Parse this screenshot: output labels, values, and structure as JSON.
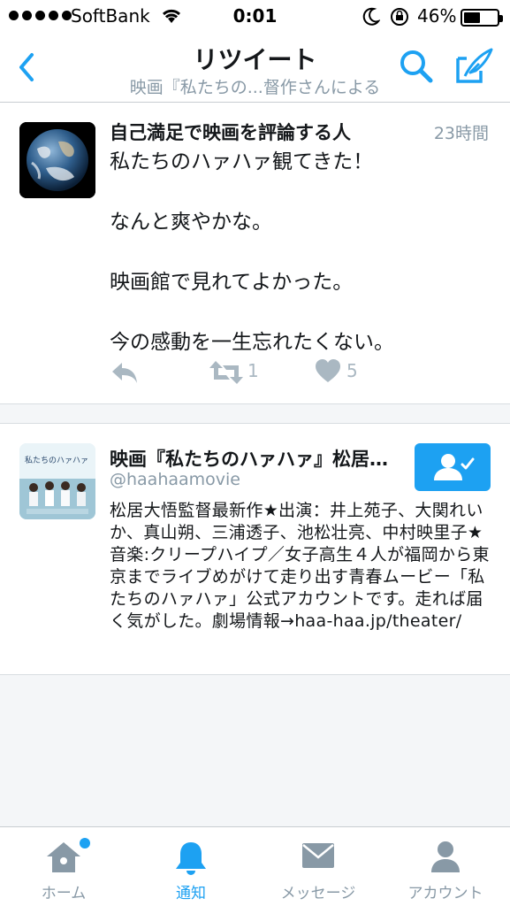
{
  "status_bar": {
    "carrier": "SoftBank",
    "time": "0:01",
    "battery_percent": "46%",
    "battery_level": 0.46
  },
  "nav": {
    "title": "リツイート",
    "subtitle": "映画『私たちの...督作さんによる",
    "icons": [
      "chevron-left-icon",
      "search-icon",
      "compose-icon"
    ],
    "accent_color": "#1DA1F2"
  },
  "tweet": {
    "author_name": "自己満足で映画を評論する人",
    "time": "23時間",
    "text": "私たちのハァハァ観てきた！\n\nなんと爽やかな。\n\n映画館で見れてよかった。\n\n今の感動を一生忘れたくない。",
    "retweet_count": "1",
    "like_count": "5"
  },
  "user": {
    "name": "映画『私たちのハァハァ』松居大悟監督作",
    "handle": "@haahaamovie",
    "avatar_caption": "私たちのハァハァ",
    "bio": "松居大悟監督最新作★出演：井上苑子、大関れいか、真山朔、三浦透子、池松壮亮、中村映里子★音楽:クリープハイプ／女子高生４人が福岡から東京までライブめがけて走り出す青春ムービー「私たちのハァハァ」公式アカウントです。走れば届く気がした。劇場情報→haa-haa.jp/theater/"
  },
  "tabs": [
    {
      "label": "ホーム",
      "icon": "home-icon"
    },
    {
      "label": "通知",
      "icon": "bell-icon"
    },
    {
      "label": "メッセージ",
      "icon": "envelope-icon"
    },
    {
      "label": "アカウント",
      "icon": "person-icon"
    }
  ]
}
